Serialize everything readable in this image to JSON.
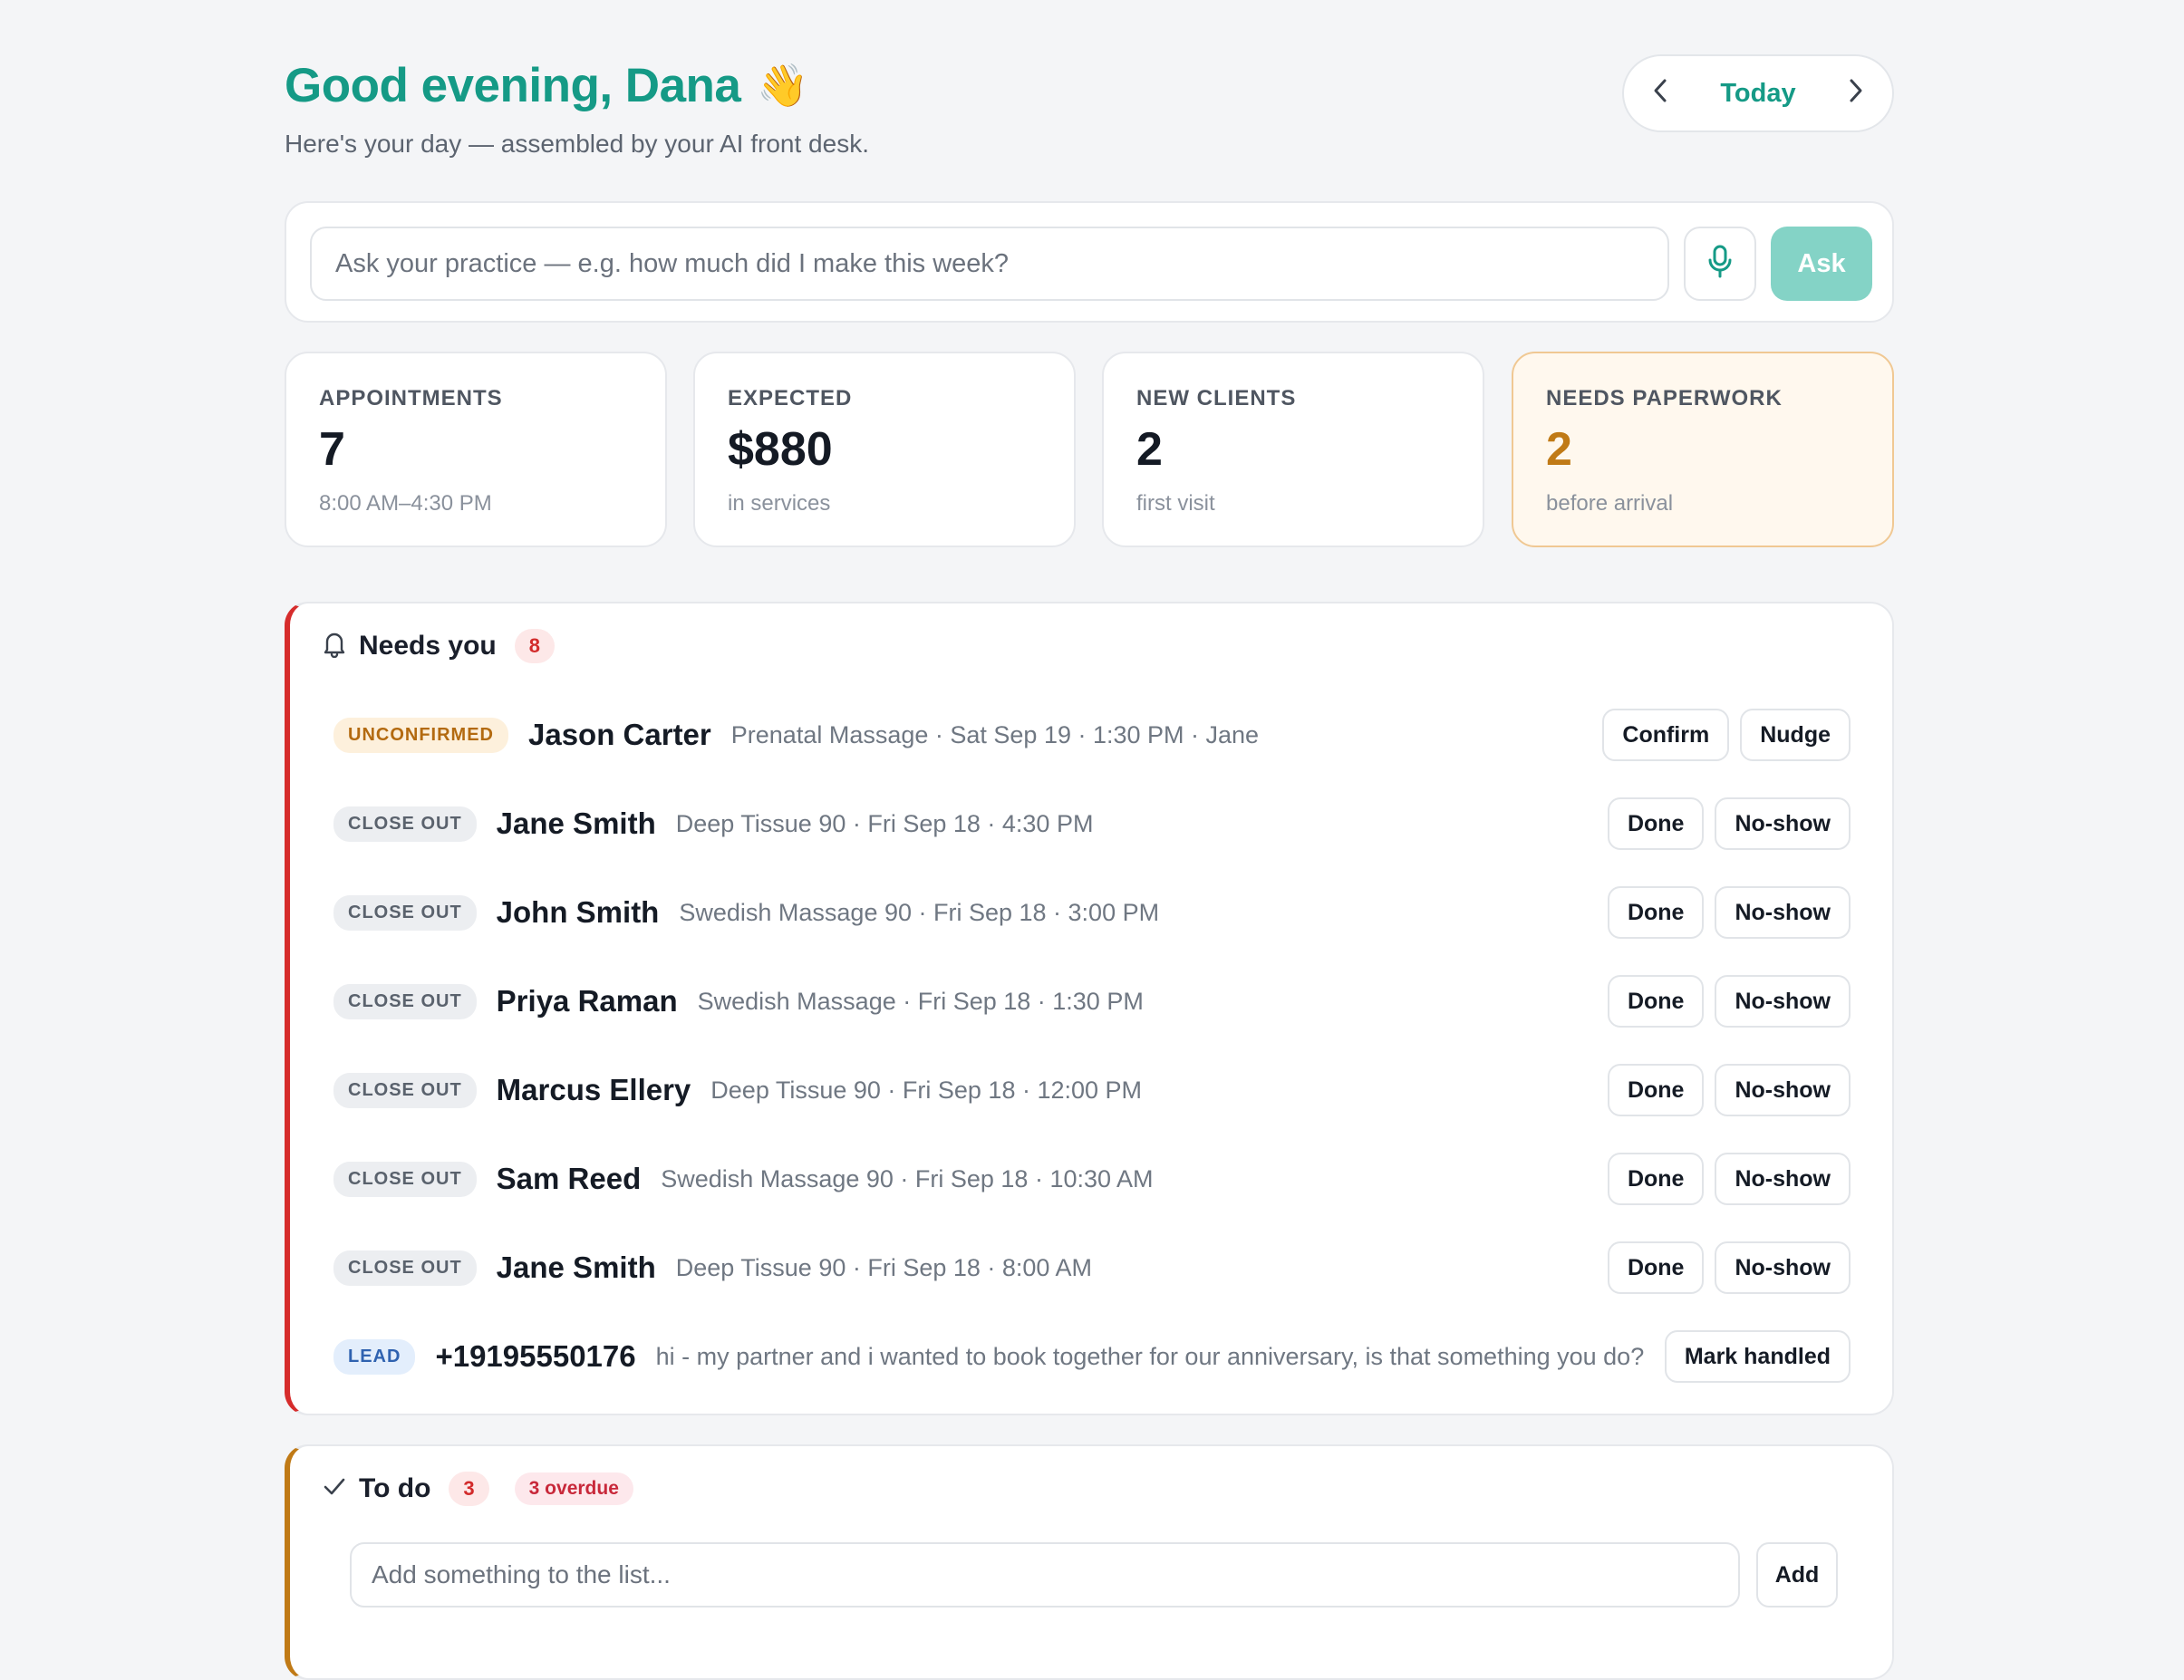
{
  "header": {
    "greeting": "Good evening, Dana",
    "greeting_emoji": "👋",
    "subtitle": "Here's your day — assembled by your AI front desk.",
    "date_label": "Today",
    "prev_icon": "chevron-left-icon",
    "next_icon": "chevron-right-icon"
  },
  "ask": {
    "placeholder": "Ask your practice — e.g. how much did I make this week?",
    "mic_icon": "microphone-icon",
    "button_label": "Ask"
  },
  "stats": [
    {
      "label": "APPOINTMENTS",
      "value": "7",
      "sub": "8:00 AM–4:30 PM"
    },
    {
      "label": "EXPECTED",
      "value": "$880",
      "sub": "in services"
    },
    {
      "label": "NEW CLIENTS",
      "value": "2",
      "sub": "first visit"
    },
    {
      "label": "NEEDS PAPERWORK",
      "value": "2",
      "sub": "before arrival"
    }
  ],
  "needs_you": {
    "title": "Needs you",
    "count": "8",
    "rows": [
      {
        "tag": "UNCONFIRMED",
        "name": "Jason Carter",
        "meta": "Prenatal Massage · Sat Sep 19 · 1:30 PM · Jane",
        "actions": [
          "Confirm",
          "Nudge"
        ]
      },
      {
        "tag": "CLOSE OUT",
        "name": "Jane Smith",
        "meta": "Deep Tissue 90 · Fri Sep 18 · 4:30 PM",
        "actions": [
          "Done",
          "No-show"
        ]
      },
      {
        "tag": "CLOSE OUT",
        "name": "John Smith",
        "meta": "Swedish Massage 90 · Fri Sep 18 · 3:00 PM",
        "actions": [
          "Done",
          "No-show"
        ]
      },
      {
        "tag": "CLOSE OUT",
        "name": "Priya Raman",
        "meta": "Swedish Massage · Fri Sep 18 · 1:30 PM",
        "actions": [
          "Done",
          "No-show"
        ]
      },
      {
        "tag": "CLOSE OUT",
        "name": "Marcus Ellery",
        "meta": "Deep Tissue 90 · Fri Sep 18 · 12:00 PM",
        "actions": [
          "Done",
          "No-show"
        ]
      },
      {
        "tag": "CLOSE OUT",
        "name": "Sam Reed",
        "meta": "Swedish Massage 90 · Fri Sep 18 · 10:30 AM",
        "actions": [
          "Done",
          "No-show"
        ]
      },
      {
        "tag": "CLOSE OUT",
        "name": "Jane Smith",
        "meta": "Deep Tissue 90 · Fri Sep 18 · 8:00 AM",
        "actions": [
          "Done",
          "No-show"
        ]
      },
      {
        "tag": "LEAD",
        "name": "+19195550176",
        "meta": "hi - my partner and i wanted to book together for our anniversary, is that something you do?",
        "actions": [
          "Mark handled"
        ]
      }
    ]
  },
  "todo": {
    "title": "To do",
    "count": "3",
    "overdue": "3 overdue",
    "placeholder": "Add something to the list...",
    "add_label": "Add"
  },
  "colors": {
    "accent": "#159a86",
    "needs_border": "#d62c2c",
    "todo_border": "#c07a16",
    "paperwork_value": "#c07a16"
  }
}
